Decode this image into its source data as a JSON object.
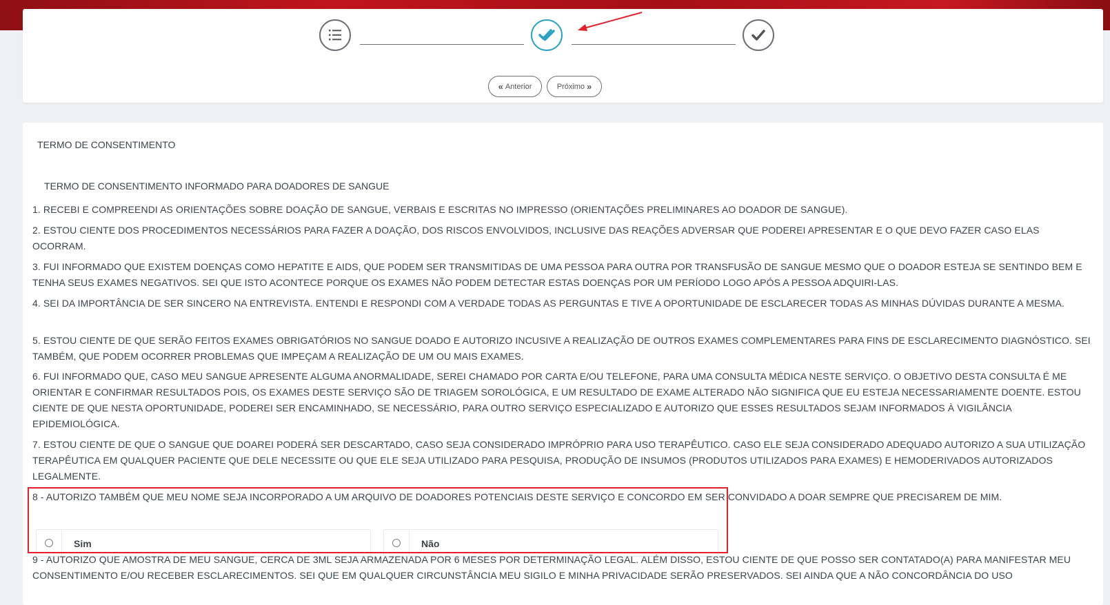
{
  "colors": {
    "banner": "#b5131a",
    "active_step": "#2aa3c3",
    "annotation": "#e4202a",
    "text": "#3d434c"
  },
  "wizard": {
    "steps": [
      {
        "icon": "list-icon",
        "state": "done"
      },
      {
        "icon": "double-check-icon",
        "state": "active"
      },
      {
        "icon": "check-icon",
        "state": "pending"
      }
    ],
    "prev_label": "Anterior",
    "next_label": "Próximo"
  },
  "consent": {
    "section_title": "TERMO DE CONSENTIMENTO",
    "subtitle": "TERMO DE CONSENTIMENTO INFORMADO PARA DOADORES DE SANGUE",
    "clauses": [
      "1. RECEBI E COMPREENDI AS ORIENTAÇÕES SOBRE DOAÇÃO DE SANGUE, VERBAIS E ESCRITAS NO IMPRESSO (ORIENTAÇÕES PRELIMINARES AO DOADOR DE SANGUE).",
      "2. ESTOU CIENTE DOS PROCEDIMENTOS NECESSÁRIOS PARA FAZER A DOAÇÃO, DOS RISCOS ENVOLVIDOS, INCLUSIVE DAS REAÇÕES ADVERSAR QUE PODEREI APRESENTAR E O QUE DEVO FAZER CASO ELAS OCORRAM.",
      "3. FUI INFORMADO QUE EXISTEM DOENÇAS COMO HEPATITE E AIDS, QUE PODEM SER TRANSMITIDAS DE UMA PESSOA PARA OUTRA POR TRANSFUSÃO DE SANGUE MESMO QUE O DOADOR ESTEJA SE SENTINDO BEM E TENHA SEUS EXAMES NEGATIVOS. SEI QUE ISTO ACONTECE PORQUE OS EXAMES NÃO PODEM DETECTAR ESTAS DOENÇAS POR UM PERÍODO LOGO APÓS A PESSOA ADQUIRI-LAS.",
      "4. SEI DA IMPORTÂNCIA DE SER SINCERO NA ENTREVISTA. ENTENDI E RESPONDI COM A VERDADE TODAS AS PERGUNTAS E TIVE A OPORTUNIDADE DE ESCLARECER TODAS AS MINHAS DÚVIDAS DURANTE A MESMA.",
      "5. ESTOU CIENTE DE QUE SERÃO FEITOS EXAMES OBRIGATÓRIOS NO SANGUE DOADO E AUTORIZO INCUSIVE A REALIZAÇÃO DE OUTROS EXAMES COMPLEMENTARES PARA FINS DE ESCLARECIMENTO DIAGNÓSTICO. SEI TAMBÉM, QUE PODEM OCORRER PROBLEMAS QUE IMPEÇAM A REALIZAÇÃO DE UM OU MAIS EXAMES.",
      "6. FUI INFORMADO QUE, CASO MEU SANGUE APRESENTE ALGUMA ANORMALIDADE, SEREI CHAMADO POR CARTA E/OU TELEFONE, PARA UMA CONSULTA MÉDICA NESTE SERVIÇO. O OBJETIVO DESTA CONSULTA É ME ORIENTAR E CONFIRMAR RESULTADOS POIS, OS EXAMES DESTE SERVIÇO SÃO DE TRIAGEM SOROLÓGICA, E UM RESULTADO DE EXAME ALTERADO NÃO SIGNIFICA QUE EU ESTEJA NECESSARIAMENTE DOENTE. ESTOU CIENTE DE QUE NESTA OPORTUNIDADE, PODEREI SER ENCAMINHADO, SE NECESSÁRIO, PARA OUTRO SERVIÇO ESPECIALIZADO E AUTORIZO QUE ESSES RESULTADOS SEJAM INFORMADOS À VIGILÂNCIA EPIDEMIOLÓGICA.",
      "7. ESTOU CIENTE DE QUE O SANGUE QUE DOAREI PODERÁ SER DESCARTADO, CASO SEJA CONSIDERADO IMPRÓPRIO PARA USO TERAPÊUTICO. CASO ELE SEJA CONSIDERADO ADEQUADO AUTORIZO A SUA UTILIZAÇÃO TERAPÊUTICA EM QUALQUER PACIENTE QUE DELE NECESSITE OU QUE ELE SEJA UTILIZADO PARA PESQUISA, PRODUÇÃO DE INSUMOS (PRODUTOS UTILIZADOS PARA EXAMES) E HEMODERIVADOS AUTORIZADOS LEGALMENTE.",
      "8 - AUTORIZO TAMBÉM QUE MEU NOME SEJA INCORPORADO A UM ARQUIVO DE DOADORES POTENCIAIS DESTE SERVIÇO E CONCORDO EM SER CONVIDADO A DOAR SEMPRE QUE PRECISAREM DE MIM.",
      "9 - AUTORIZO QUE AMOSTRA DE MEU SANGUE, CERCA DE 3ML SEJA ARMAZENADA POR 6 MESES POR DETERMINAÇÃO LEGAL. ALÉM DISSO, ESTOU CIENTE DE QUE POSSO SER CONTATADO(A) PARA MANIFESTAR MEU CONSENTIMENTO E/OU RECEBER ESCLARECIMENTOS. SEI QUE EM QUALQUER CIRCUNSTÂNCIA MEU SIGILO E MINHA PRIVACIDADE SERÃO PRESERVADOS. SEI AINDA QUE A NÃO CONCORDÂNCIA DO USO"
    ],
    "options": [
      "Sim",
      "Não"
    ]
  }
}
